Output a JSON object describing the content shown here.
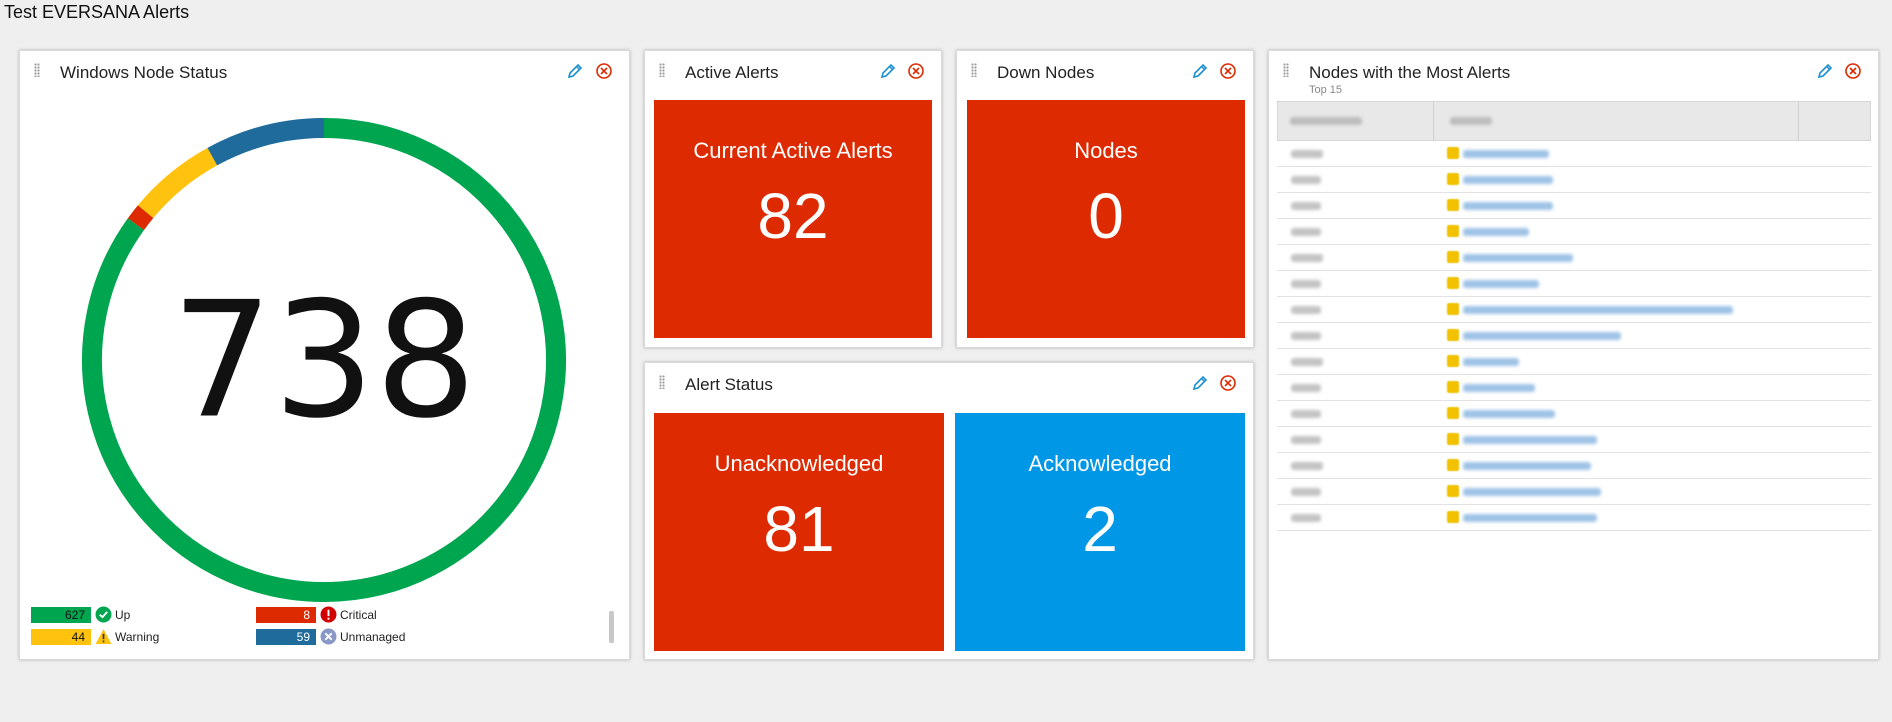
{
  "page": {
    "title": "Test EVERSANA Alerts"
  },
  "widgets": {
    "windows_node_status": {
      "title": "Windows Node Status",
      "total": "738",
      "segments": [
        {
          "name": "Up",
          "value": 627,
          "color": "#00a54f"
        },
        {
          "name": "Critical",
          "value": 8,
          "color": "#de2a00"
        },
        {
          "name": "Warning",
          "value": 44,
          "color": "#ffc20e"
        },
        {
          "name": "Unmanaged",
          "value": 59,
          "color": "#1f6b9c"
        }
      ],
      "legend": {
        "up": {
          "count": "627",
          "label": "Up",
          "color": "#00a54f"
        },
        "warning": {
          "count": "44",
          "label": "Warning",
          "color": "#ffc20e"
        },
        "critical": {
          "count": "8",
          "label": "Critical",
          "color": "#de2a00"
        },
        "unmanaged": {
          "count": "59",
          "label": "Unmanaged",
          "color": "#1f6b9c"
        }
      }
    },
    "active_alerts": {
      "title": "Active Alerts",
      "tile_label": "Current Active Alerts",
      "tile_value": "82"
    },
    "down_nodes": {
      "title": "Down Nodes",
      "tile_label": "Nodes",
      "tile_value": "0"
    },
    "alert_status": {
      "title": "Alert Status",
      "unack_label": "Unacknowledged",
      "unack_value": "81",
      "ack_label": "Acknowledged",
      "ack_value": "2"
    },
    "nodes_most_alerts": {
      "title": "Nodes with the Most Alerts",
      "subtitle": "Top 15"
    }
  },
  "colors": {
    "red_tile": "#de2a00",
    "blue_tile": "#0097e6",
    "edit_icon": "#1a8fd1",
    "close_icon": "#de2a00"
  }
}
